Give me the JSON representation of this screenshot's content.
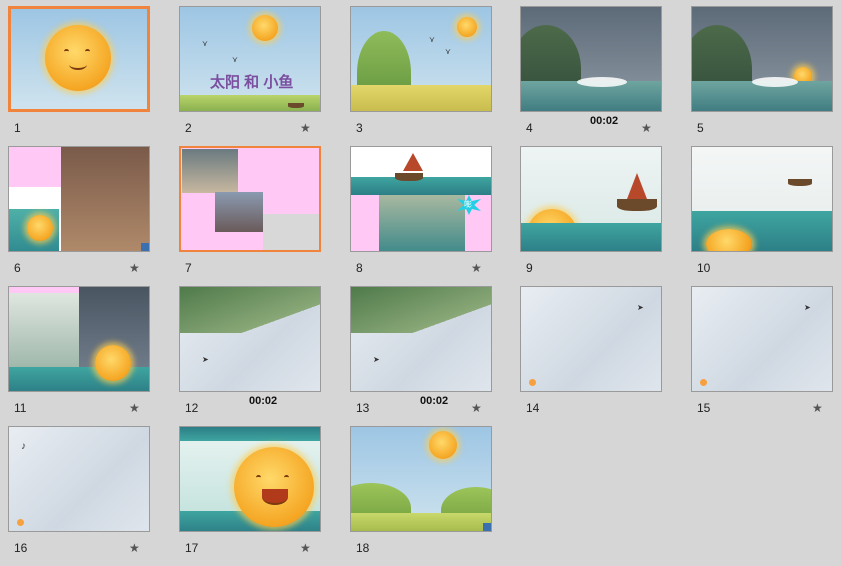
{
  "slides": [
    {
      "number": "1",
      "timing": "",
      "has_animation": false
    },
    {
      "number": "2",
      "timing": "",
      "has_animation": true,
      "title_text": "太阳 和 小鱼"
    },
    {
      "number": "3",
      "timing": "",
      "has_animation": false
    },
    {
      "number": "4",
      "timing": "00:02",
      "has_animation": true
    },
    {
      "number": "5",
      "timing": "",
      "has_animation": false
    },
    {
      "number": "6",
      "timing": "",
      "has_animation": true
    },
    {
      "number": "7",
      "timing": "",
      "has_animation": false
    },
    {
      "number": "8",
      "timing": "",
      "has_animation": true,
      "burst_text": "嘭"
    },
    {
      "number": "9",
      "timing": "",
      "has_animation": false
    },
    {
      "number": "10",
      "timing": "",
      "has_animation": false
    },
    {
      "number": "11",
      "timing": "",
      "has_animation": true
    },
    {
      "number": "12",
      "timing": "00:02",
      "has_animation": false
    },
    {
      "number": "13",
      "timing": "00:02",
      "has_animation": true
    },
    {
      "number": "14",
      "timing": "",
      "has_animation": false
    },
    {
      "number": "15",
      "timing": "",
      "has_animation": true
    },
    {
      "number": "16",
      "timing": "",
      "has_animation": true
    },
    {
      "number": "17",
      "timing": "",
      "has_animation": true
    },
    {
      "number": "18",
      "timing": "",
      "has_animation": false
    }
  ],
  "animation_icon": "★",
  "colors": {
    "selection": "#f0843c",
    "background": "#d6d6d6"
  }
}
